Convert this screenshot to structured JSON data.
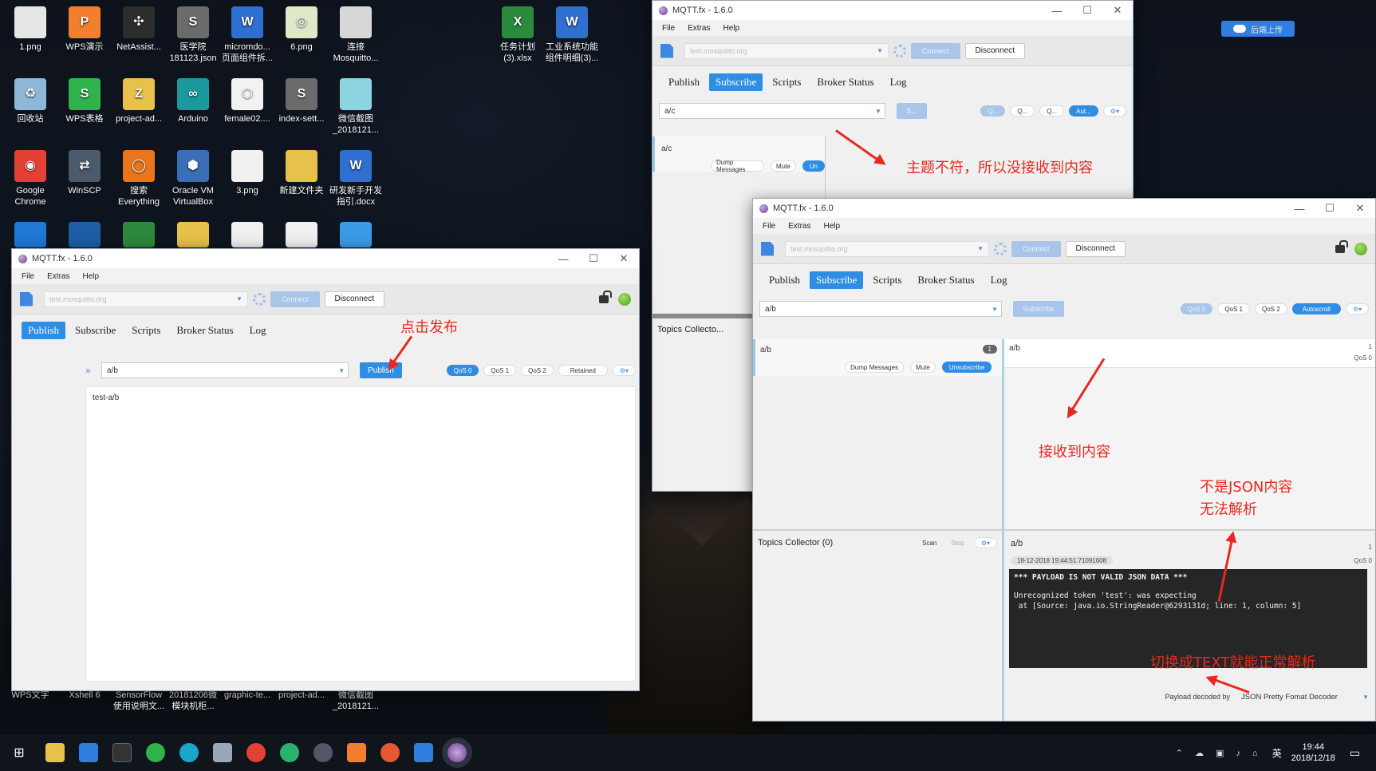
{
  "desktop": {
    "icons": [
      {
        "label": "1.png",
        "color": "#e6e6e6",
        "glyph": ""
      },
      {
        "label": "WPS演示",
        "color": "#f27e2e",
        "glyph": "P"
      },
      {
        "label": "NetAssist...",
        "color": "#2d2d2d",
        "glyph": "✣"
      },
      {
        "label": "医学院 181123.json",
        "color": "#6b6b6b",
        "glyph": "S"
      },
      {
        "label": "micromdo... 页面组件拆...",
        "color": "#2f6fd0",
        "glyph": "W"
      },
      {
        "label": "6.png",
        "color": "#dfe9c8",
        "glyph": "◎"
      },
      {
        "label": "连接 Mosquitto...",
        "color": "#d7d7d7",
        "glyph": ""
      },
      {
        "label": "回收站",
        "color": "#8fb8d8",
        "glyph": "♻"
      },
      {
        "label": "WPS表格",
        "color": "#2fb34a",
        "glyph": "S"
      },
      {
        "label": "project-ad...",
        "color": "#e8c14a",
        "glyph": "Z"
      },
      {
        "label": "Arduino",
        "color": "#1a9a9c",
        "glyph": "∞"
      },
      {
        "label": "female02....",
        "color": "#f2f2f2",
        "glyph": "⬡"
      },
      {
        "label": "index-sett...",
        "color": "#6b6b6b",
        "glyph": "S"
      },
      {
        "label": "微信截图 _2018121...",
        "color": "#8bd4e0",
        "glyph": ""
      },
      {
        "label": "Google Chrome",
        "color": "#e34133",
        "glyph": "◉"
      },
      {
        "label": "WinSCP",
        "color": "#4a5a6a",
        "glyph": "⇄"
      },
      {
        "label": "搜索 Everything",
        "color": "#e8761c",
        "glyph": "◯"
      },
      {
        "label": "Oracle VM VirtualBox",
        "color": "#3b6fb5",
        "glyph": "⬢"
      },
      {
        "label": "3.png",
        "color": "#f0f0f0",
        "glyph": ""
      },
      {
        "label": "新建文件夹",
        "color": "#e8c14a",
        "glyph": ""
      },
      {
        "label": "研发新手开发 指引.docx",
        "color": "#2f6fd0",
        "glyph": "W"
      },
      {
        "label": "任务计划 (3).xlsx",
        "color": "#2c8a3c",
        "glyph": "X"
      },
      {
        "label": "工业系统功能 组件明细(3)...",
        "color": "#2f6fd0",
        "glyph": "W"
      }
    ],
    "bottom_labels": [
      "WPS文字",
      "Xshell 6",
      "SensorFlow 使用说明文...",
      "20181206微 模块机柜...",
      "graphic-te...",
      "project-ad...",
      "微信截图 _2018121..."
    ],
    "upload_badge": "后端上传"
  },
  "window_a": {
    "title": "MQTT.fx - 1.6.0",
    "menu": [
      "File",
      "Extras",
      "Help"
    ],
    "broker": "test.mosquitto.org",
    "connect": "Connect",
    "disconnect": "Disconnect",
    "tabs": [
      "Publish",
      "Subscribe",
      "Scripts",
      "Broker Status",
      "Log"
    ],
    "topic": "a/c",
    "subscribe_short": "S...",
    "qos_short": [
      "Q...",
      "Q...",
      "Q..."
    ],
    "autoscroll_short": "Aut...",
    "sub_topic": "a/c",
    "dump": "Dump Messages",
    "mute": "Mute",
    "unsub_short": "Un",
    "topics_collector": "Topics Collecto..."
  },
  "window_b": {
    "title": "MQTT.fx - 1.6.0",
    "menu": [
      "File",
      "Extras",
      "Help"
    ],
    "broker": "test.mosquitto.org",
    "connect": "Connect",
    "disconnect": "Disconnect",
    "tabs": [
      "Publish",
      "Subscribe",
      "Scripts",
      "Broker Status",
      "Log"
    ],
    "topic": "a/b",
    "publish": "Publish",
    "qos": [
      "QoS 0",
      "QoS 1",
      "QoS 2"
    ],
    "retained": "Retained",
    "payload": "test-a/b"
  },
  "window_c": {
    "title": "MQTT.fx - 1.6.0",
    "menu": [
      "File",
      "Extras",
      "Help"
    ],
    "broker": "test.mosquitto.org",
    "connect": "Connect",
    "disconnect": "Disconnect",
    "tabs": [
      "Publish",
      "Subscribe",
      "Scripts",
      "Broker Status",
      "Log"
    ],
    "topic": "a/b",
    "subscribe": "Subscribe",
    "qos": [
      "QoS 0",
      "QoS 1",
      "QoS 2"
    ],
    "autoscroll": "Autoscroll",
    "sub_topic": "a/b",
    "sub_count": "1",
    "dump": "Dump Messages",
    "mute": "Mute",
    "unsubscribe": "Unsubscribe",
    "topics_collector": "Topics Collector (0)",
    "scan": "Scan",
    "stop": "Stop",
    "msg_topic": "a/b",
    "msg_num": "1",
    "msg_qos": "QoS 0",
    "detail_topic": "a/b",
    "detail_num": "1",
    "detail_time": "18-12-2018  19:44:51.71091608",
    "detail_qos": "QoS 0",
    "payload_line1": "*** PAYLOAD IS NOT VALID JSON DATA ***",
    "payload_line2": "Unrecognized token 'test': was expecting",
    "payload_line3": " at [Source: java.io.StringReader@6293131d; line: 1, column: 5]",
    "decoded_by_label": "Payload decoded by",
    "decoder": "JSON Pretty Fomat Decoder"
  },
  "annotations": {
    "mismatch": "主题不符，所以没接收到内容",
    "click_publish": "点击发布",
    "received": "接收到内容",
    "not_json_1": "不是JSON内容",
    "not_json_2": "无法解析",
    "switch_text": "切换成TEXT就能正常解析"
  },
  "taskbar": {
    "lang": "英",
    "time": "19:44",
    "date": "2018/12/18"
  }
}
